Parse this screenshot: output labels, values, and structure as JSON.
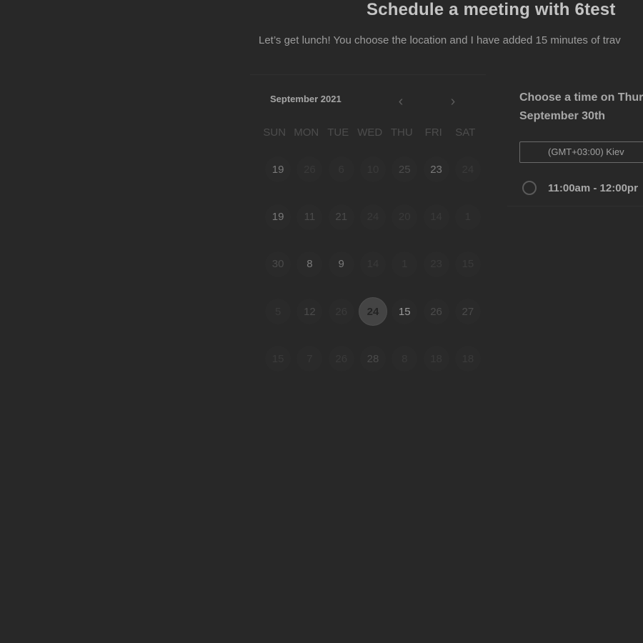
{
  "header": {
    "title": "Schedule a meeting with 6test",
    "subtitle": "Let’s get lunch! You choose the location and I have added 15 minutes of trav"
  },
  "calendar": {
    "month_label": "September 2021",
    "prev_icon": "chevron-left-icon",
    "next_icon": "chevron-right-icon",
    "weekdays": [
      "SUN",
      "MON",
      "TUE",
      "WED",
      "THU",
      "FRI",
      "SAT"
    ],
    "weeks": [
      [
        "19",
        "26",
        "6",
        "10",
        "25",
        "23",
        "24"
      ],
      [
        "19",
        "11",
        "21",
        "24",
        "20",
        "14",
        "1"
      ],
      [
        "30",
        "8",
        "9",
        "14",
        "1",
        "23",
        "15"
      ],
      [
        "5",
        "12",
        "26",
        "24",
        "15",
        "26",
        "27"
      ],
      [
        "15",
        "7",
        "26",
        "28",
        "8",
        "18",
        "18"
      ]
    ],
    "selected_day": "24"
  },
  "time_panel": {
    "title_line1": "Choose a time on Thur",
    "title_line2": "September 30th",
    "timezone": "(GMT+03:00) Kiev",
    "slots": [
      {
        "label": "11:00am - 12:00pr"
      }
    ]
  },
  "colors": {
    "background": "#282828",
    "selected_day_bg": "#444444"
  }
}
